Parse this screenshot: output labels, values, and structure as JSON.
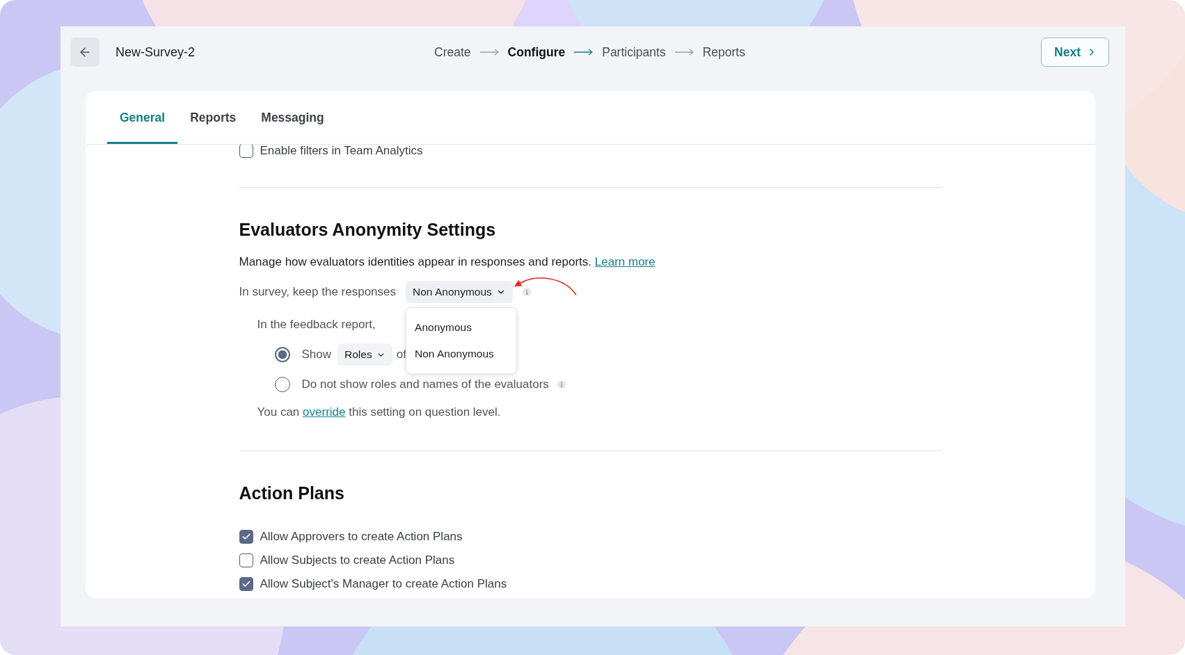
{
  "header": {
    "title": "New-Survey-2"
  },
  "stepper": [
    {
      "label": "Create",
      "selected": false
    },
    {
      "label": "Configure",
      "selected": true
    },
    {
      "label": "Participants",
      "selected": false
    },
    {
      "label": "Reports",
      "selected": false
    }
  ],
  "next_button": {
    "label": "Next"
  },
  "tabs": [
    {
      "label": "General",
      "selected": true
    },
    {
      "label": "Reports",
      "selected": false
    },
    {
      "label": "Messaging",
      "selected": false
    }
  ],
  "filters_option": {
    "label": "Enable filters in Team Analytics",
    "checked": false
  },
  "anonymity_section": {
    "title": "Evaluators Anonymity Settings",
    "description": "Manage how evaluators identities appear in responses and reports.",
    "learn_more_link": "Learn more",
    "survey_label": "In survey, keep the responses",
    "survey_dropdown": {
      "value": "Non Anonymous",
      "expanded": true,
      "options": [
        "Anonymous",
        "Non Anonymous"
      ]
    },
    "report_label": "In the feedback report,",
    "report_options": [
      {
        "kind": "with_dropdown",
        "selected": true,
        "label": "Show",
        "dropdown": {
          "value": "Roles"
        },
        "suffix": "of"
      },
      {
        "kind": "with_info",
        "selected": false,
        "label": "Do not show roles and names of the evaluators"
      }
    ],
    "override_note": {
      "before": "You can",
      "link": "override",
      "after": "this setting on question level."
    }
  },
  "action_plans": {
    "title": "Action Plans",
    "options": [
      {
        "label": "Allow Approvers to create Action Plans",
        "checked": true
      },
      {
        "label": "Allow Subjects to create Action Plans",
        "checked": false
      },
      {
        "label": "Allow Subject's Manager to create Action Plans",
        "checked": true
      }
    ]
  }
}
